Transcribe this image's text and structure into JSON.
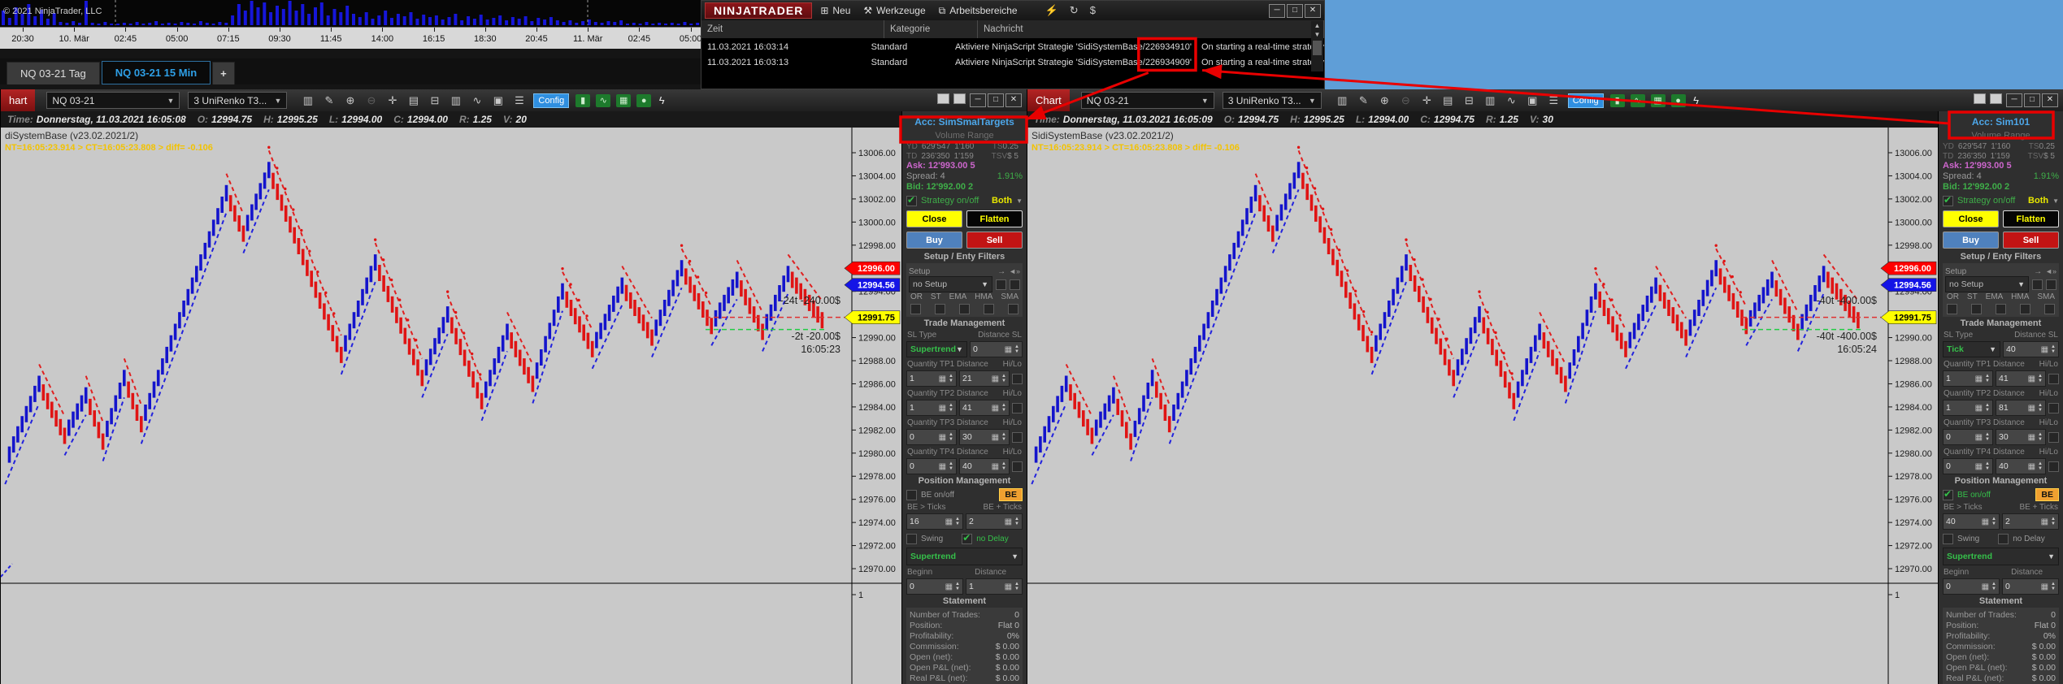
{
  "top_chart": {
    "copyright": "© 2021 NinjaTrader, LLC",
    "tabs": [
      {
        "label": "NQ 03-21 Tag",
        "active": false
      },
      {
        "label": "NQ 03-21 15 Min",
        "active": true
      },
      {
        "label": "+",
        "active": false,
        "plus": true
      }
    ]
  },
  "control_center": {
    "logo": "NINJATRADER",
    "menu": [
      {
        "icon": "new-window-icon",
        "glyph": "⊞",
        "label": "Neu"
      },
      {
        "icon": "tools-icon",
        "glyph": "⚒",
        "label": "Werkzeuge"
      },
      {
        "icon": "workspaces-icon",
        "glyph": "⧉",
        "label": "Arbeitsbereiche"
      }
    ],
    "title_icons": [
      {
        "name": "plug-icon",
        "glyph": "⚡"
      },
      {
        "name": "refresh-icon",
        "glyph": "↻"
      },
      {
        "name": "dollar-icon",
        "glyph": "$"
      }
    ],
    "window_buttons": [
      "─",
      "□",
      "✕"
    ],
    "columns": [
      "Zeit",
      "Kategorie",
      "Nachricht"
    ],
    "rows": [
      {
        "zeit": "11.03.2021 16:03:14",
        "kategorie": "Standard",
        "msg_prefix": "Aktiviere NinjaScript Strategie 'SidiSystemBase",
        "msg_num": "/226934910'",
        "msg_suffix": "On starting a real-time strategy"
      },
      {
        "zeit": "11.03.2021 16:03:13",
        "kategorie": "Standard",
        "msg_prefix": "Aktiviere NinjaScript Strategie 'SidiSystemBase",
        "msg_num": "/226934909'",
        "msg_suffix": "On starting a real-time strategy"
      }
    ]
  },
  "toolbar": {
    "icons": [
      {
        "name": "price-bars-icon",
        "glyph": "▥"
      },
      {
        "name": "draw-icon",
        "glyph": "✎"
      },
      {
        "name": "zoom-in-icon",
        "glyph": "⊕"
      },
      {
        "name": "zoom-out-icon",
        "glyph": "⊖",
        "dim": true
      },
      {
        "name": "crosshair-icon",
        "glyph": "✛"
      },
      {
        "name": "data-series-icon",
        "glyph": "▤"
      },
      {
        "name": "alerts-icon",
        "glyph": "⊟"
      },
      {
        "name": "volume-icon",
        "glyph": "▥"
      },
      {
        "name": "indicator-icon",
        "glyph": "∿"
      },
      {
        "name": "snapshot-icon",
        "glyph": "▣"
      },
      {
        "name": "properties-icon",
        "glyph": "☰"
      }
    ],
    "config_label": "Config",
    "green_icons": [
      {
        "name": "order-entry-icon",
        "glyph": "▮"
      },
      {
        "name": "strategy-icon",
        "glyph": "∿"
      },
      {
        "name": "chart-trader-icon",
        "glyph": "▦"
      },
      {
        "name": "marker-icon",
        "glyph": "●"
      }
    ],
    "lightning_icon": "ϟ",
    "window_buttons": [
      "─",
      "□",
      "✕"
    ]
  },
  "panel_labels": {
    "subtitle": "Volume Range",
    "strategy": "Strategy on/off",
    "mode": "Both",
    "close": "Close",
    "flatten": "Flatten",
    "buy": "Buy",
    "sell": "Sell",
    "setup_header": "Setup / Enty Filters",
    "setup": "Setup",
    "arrow": "→",
    "speaker": "◄»",
    "no_setup": "no Setup",
    "filters": [
      "OR",
      "ST",
      "EMA",
      "HMA",
      "SMA"
    ],
    "trade_header": "Trade Management",
    "sl_type": "SL Type",
    "distance_sl": "Distance SL",
    "tp_labels": [
      "Quantity TP1 Distance",
      "Quantity TP2 Distance",
      "Quantity TP3 Distance",
      "Quantity TP4 Distance"
    ],
    "hilo": "Hi/Lo",
    "position_header": "Position Management",
    "be_onoff": "BE on/off",
    "be": "BE",
    "be_gt": "BE > Ticks",
    "be_plus": "BE + Ticks",
    "swing": "Swing",
    "no_delay": "no Delay",
    "beginn": "Beginn",
    "distance": "Distance",
    "statement_header": "Statement",
    "statement_labels": [
      "Number of Trades:",
      "Position:",
      "Profitability:",
      "Commission:",
      "Open (net):",
      "Open P&L (net):",
      "Real P&L (net):"
    ]
  },
  "windows": [
    {
      "side": "left",
      "title": "hart",
      "instrument": "NQ 03-21",
      "period": "3 UniRenko T3...",
      "status": {
        "time_label": "Time:",
        "time": "Donnerstag, 11.03.2021 16:05:08",
        "fields": [
          [
            "O:",
            "12994.75"
          ],
          [
            "H:",
            "12995.25"
          ],
          [
            "L:",
            "12994.00"
          ],
          [
            "C:",
            "12994.00"
          ],
          [
            "R:",
            "1.25"
          ],
          [
            "V:",
            "20"
          ]
        ]
      },
      "indicator_label": "diSystemBase (v23.02.2021/2)",
      "debug_text": "NT=16:05:23.914 > CT=16:05:23.808 > diff= -0.106",
      "chart_annotations": {
        "upper": "-24t -240.00$",
        "lower": "-2t -20.00$",
        "time": "16:05:23"
      },
      "panel": {
        "account": "Acc: SimSmalTargets",
        "stats": [
          [
            "YD",
            "629'547",
            "1'160",
            "TS",
            "0.25"
          ],
          [
            "TD",
            "236'350",
            "1'159",
            "TSV",
            "$ 5"
          ]
        ],
        "ask": "Ask: 12'993.00 5",
        "spread": "Spread: 4",
        "spread_pct": "1.91%",
        "bid": "Bid: 12'992.00 2",
        "strategy_checked": true,
        "sl_type_value": "Supertrend",
        "distance_sl_value": "0",
        "tp": [
          {
            "qty": "1",
            "dist": "21"
          },
          {
            "qty": "1",
            "dist": "41"
          },
          {
            "qty": "0",
            "dist": "30"
          },
          {
            "qty": "0",
            "dist": "40"
          }
        ],
        "be_checked": false,
        "be_gt_value": "16",
        "be_plus_value": "2",
        "swing_checked": false,
        "nodelay_checked": true,
        "trail": "Supertrend",
        "beginn_value": "0",
        "distance_value": "1",
        "statement_values": [
          "0",
          "Flat 0",
          "0%",
          "$ 0.00",
          "$ 0.00",
          "$ 0.00",
          "$ 0.00"
        ]
      }
    },
    {
      "side": "right",
      "title": "Chart",
      "instrument": "NQ 03-21",
      "period": "3 UniRenko T3...",
      "status": {
        "time_label": "Time:",
        "time": "Donnerstag, 11.03.2021 16:05:09",
        "fields": [
          [
            "O:",
            "12994.75"
          ],
          [
            "H:",
            "12995.25"
          ],
          [
            "L:",
            "12994.00"
          ],
          [
            "C:",
            "12994.75"
          ],
          [
            "R:",
            "1.25"
          ],
          [
            "V:",
            "30"
          ]
        ]
      },
      "indicator_label": "SidiSystemBase (v23.02.2021/2)",
      "debug_text": "NT=16:05:23.914 > CT=16:05:23.808 > diff= -0.106",
      "chart_annotations": {
        "upper": "-40t -400.00$",
        "lower": "-40t -400.00$",
        "time": "16:05:24"
      },
      "panel": {
        "account": "Acc: Sim101",
        "stats": [
          [
            "YD",
            "629'547",
            "1'160",
            "TS",
            "0.25"
          ],
          [
            "TD",
            "236'350",
            "1'159",
            "TSV",
            "$ 5"
          ]
        ],
        "ask": "Ask: 12'993.00 5",
        "spread": "Spread: 4",
        "spread_pct": "1.91%",
        "bid": "Bid: 12'992.00 2",
        "strategy_checked": true,
        "sl_type_value": "Tick",
        "distance_sl_value": "40",
        "tp": [
          {
            "qty": "1",
            "dist": "41"
          },
          {
            "qty": "1",
            "dist": "81"
          },
          {
            "qty": "0",
            "dist": "30"
          },
          {
            "qty": "0",
            "dist": "40"
          }
        ],
        "be_checked": true,
        "be_gt_value": "40",
        "be_plus_value": "2",
        "swing_checked": false,
        "nodelay_checked": false,
        "trail": "Supertrend",
        "beginn_value": "0",
        "distance_value": "0",
        "statement_values": [
          "0",
          "Flat 0",
          "0%",
          "$ 0.00",
          "$ 0.00",
          "$ 0.00",
          "$ 0.00"
        ]
      }
    }
  ],
  "chart_data": {
    "renko": {
      "type": "renko",
      "instrument": "NQ 03-21",
      "period": "3 UniRenko T3",
      "up_color": "#1414cc",
      "down_color": "#e01414",
      "y_ticks": [
        "13006.00",
        "13004.00",
        "13002.00",
        "13000.00",
        "12998.00",
        "12996.00",
        "12994.00",
        "12992.00",
        "12990.00",
        "12988.00",
        "12986.00",
        "12984.00",
        "12982.00",
        "12980.00",
        "12978.00",
        "12976.00",
        "12974.00",
        "12972.00",
        "12970.00"
      ],
      "y_top_price": 13006,
      "y_bottom_price": 12970,
      "waypoints": [
        [
          0.005,
          12979
        ],
        [
          0.045,
          12986
        ],
        [
          0.075,
          12981.5
        ],
        [
          0.1,
          12985
        ],
        [
          0.12,
          12981
        ],
        [
          0.145,
          12986.5
        ],
        [
          0.165,
          12982.5
        ],
        [
          0.265,
          13002.5
        ],
        [
          0.285,
          12999
        ],
        [
          0.315,
          13004.5
        ],
        [
          0.4,
          12988.5
        ],
        [
          0.44,
          12996.5
        ],
        [
          0.495,
          12986.5
        ],
        [
          0.525,
          12992
        ],
        [
          0.565,
          12984.5
        ],
        [
          0.595,
          12990.5
        ],
        [
          0.625,
          12986
        ],
        [
          0.66,
          12994
        ],
        [
          0.695,
          12989
        ],
        [
          0.73,
          12994.5
        ],
        [
          0.765,
          12990
        ],
        [
          0.8,
          12996
        ],
        [
          0.835,
          12991
        ],
        [
          0.865,
          12995
        ],
        [
          0.895,
          12990.5
        ],
        [
          0.925,
          12995.5
        ],
        [
          0.965,
          12991.5
        ]
      ],
      "badges": [
        {
          "label": "12996.00",
          "price": 12996.0,
          "bg": "#ff0000",
          "fg": "#ffffff"
        },
        {
          "label": "12994.56",
          "price": 12994.56,
          "bg": "#1414e6",
          "fg": "#ffffff"
        },
        {
          "label": "12991.75",
          "price": 12991.75,
          "bg": "#ffff00",
          "fg": "#000000"
        }
      ],
      "levels": [
        {
          "price": 12991.75,
          "color": "#e03030"
        },
        {
          "price": 12990.7,
          "color": "#22cc44"
        }
      ],
      "sub_panel_tick": "1"
    },
    "volume_strip": {
      "type": "bar",
      "bar_color": "#1616d9",
      "heights": [
        18,
        9,
        22,
        14,
        26,
        11,
        19,
        8,
        15,
        4,
        3,
        5,
        3,
        30,
        3,
        2,
        4,
        2,
        2,
        3,
        2,
        4,
        2,
        3,
        5,
        2,
        3,
        2,
        4,
        3,
        2,
        5,
        3,
        2,
        4,
        3,
        12,
        26,
        18,
        30,
        22,
        28,
        16,
        24,
        20,
        30,
        18,
        26,
        14,
        22,
        28,
        12,
        20,
        16,
        24,
        14,
        10,
        16,
        8,
        12,
        18,
        9,
        14,
        11,
        16,
        8,
        13,
        10,
        12,
        7,
        10,
        14,
        6,
        11,
        8,
        13,
        7,
        9,
        12,
        6,
        10,
        8,
        11,
        5,
        9,
        7,
        10,
        6,
        4,
        6,
        3,
        5,
        7,
        4,
        3,
        5,
        4,
        6,
        2,
        3,
        2,
        4,
        2,
        3,
        2,
        3,
        2,
        4,
        2,
        3
      ],
      "time_labels": [
        "20:30",
        "10. Mär",
        "02:45",
        "05:00",
        "07:15",
        "09:30",
        "11:45",
        "14:00",
        "16:15",
        "18:30",
        "20:45",
        "11. Mär",
        "02:45",
        "05:00"
      ],
      "session_break_x": [
        142,
        723
      ]
    }
  },
  "annotation_color": "#e80000"
}
